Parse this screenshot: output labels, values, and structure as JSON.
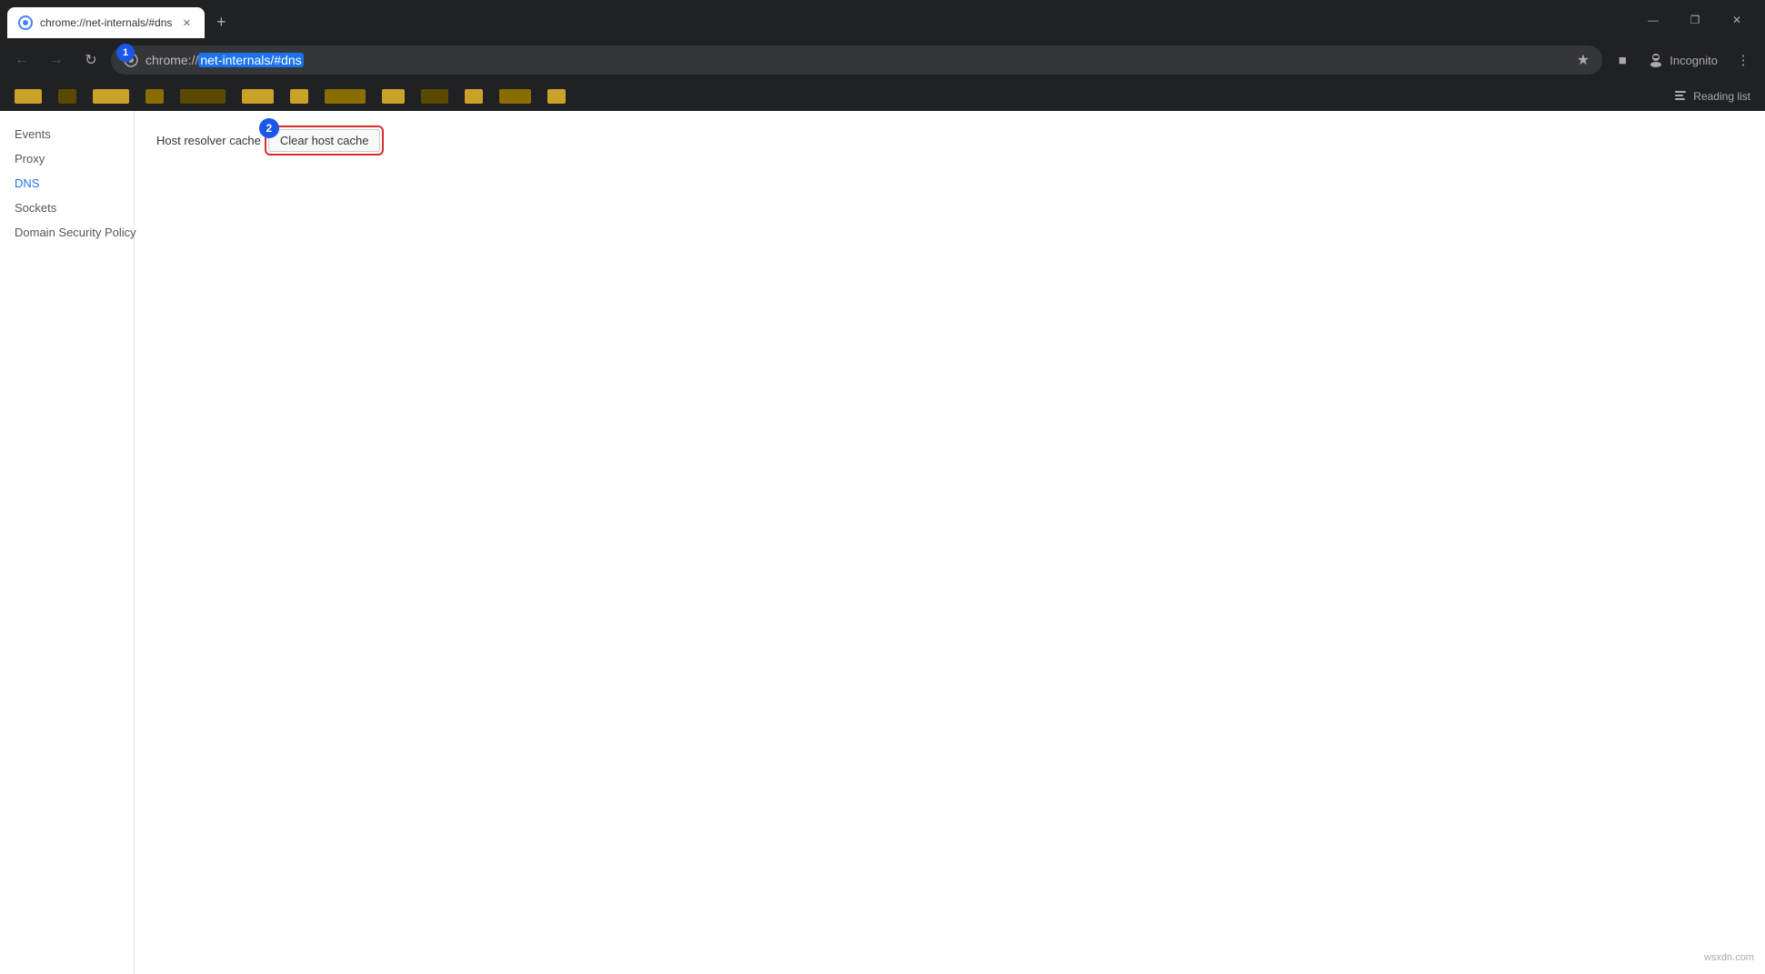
{
  "browser": {
    "tab": {
      "title": "chrome://net-internals/#dns",
      "favicon_label": "chrome-favicon"
    },
    "new_tab_button": "+",
    "window_controls": {
      "minimize": "—",
      "restore": "❐",
      "close": "✕"
    },
    "address_bar": {
      "url_prefix": "chrome://",
      "url_highlight": "net-internals/#dns",
      "full_url": "chrome://net-internals/#dns"
    },
    "incognito_label": "Incognito",
    "reading_list_label": "Reading list",
    "bookmarks_bar": {
      "items": []
    }
  },
  "sidebar": {
    "items": [
      {
        "id": "events",
        "label": "Events",
        "active": false
      },
      {
        "id": "proxy",
        "label": "Proxy",
        "active": false
      },
      {
        "id": "dns",
        "label": "DNS",
        "active": true
      },
      {
        "id": "sockets",
        "label": "Sockets",
        "active": false
      },
      {
        "id": "domain-security",
        "label": "Domain Security Policy",
        "active": false
      }
    ]
  },
  "main": {
    "host_resolver_label": "Host resolver cache",
    "clear_cache_button_label": "Clear host cache",
    "badge1_number": "1",
    "badge2_number": "2"
  },
  "watermark": "wsxdn.com"
}
